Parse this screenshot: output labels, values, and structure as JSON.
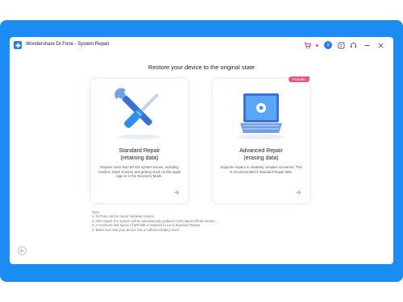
{
  "window": {
    "title": "Wondershare Dr.Fone - System Repair",
    "avatar_letter": "S"
  },
  "page": {
    "heading": "Restore your device to the original state"
  },
  "cards": [
    {
      "title_line1": "Standard Repair",
      "title_line2": "(retaining data)",
      "description": "Repairs more than 50 iOS system issues, including crashes, black screens and getting stuck on the Apple logo or in the Recovery Mode.",
      "icon": "tools-icon"
    },
    {
      "badge": "Popular",
      "title_line1": "Advanced Repair",
      "title_line2": "(erasing data)",
      "description": "Supports repairs in relatively complex scenarios. This is recommended if Standard Repair fails.",
      "icon": "laptop-gear-icon"
    }
  ],
  "notes": {
    "label": "Note:",
    "items": [
      "1. Dr.Fone cannot repair hardware issues.",
      "2. After repair, the system will be automatically updated to the latest official version.",
      "3. A minimum disk space of 500 MB is required to run a Standard Repair.",
      "4. Make sure that your device has a sufficient battery level."
    ]
  },
  "colors": {
    "frame": "#1a8cf2",
    "accent": "#1a7cf0",
    "badge": "#f0508c"
  }
}
